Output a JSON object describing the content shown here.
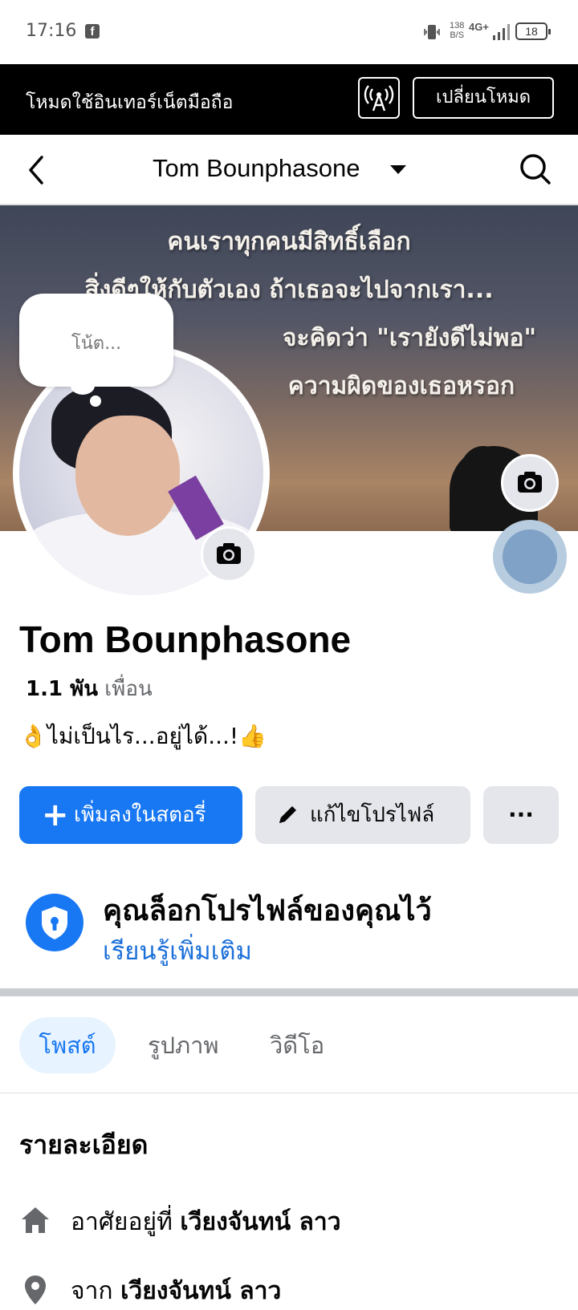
{
  "status_bar": {
    "time": "17:16",
    "app_icon": "facebook-icon",
    "speed_value": "138",
    "speed_unit": "B/S",
    "network": "4G+",
    "battery": "18"
  },
  "data_banner": {
    "text": "โหมดใช้อินเทอร์เน็ตมือถือ",
    "switch_label": "เปลี่ยนโหมด"
  },
  "header": {
    "title": "Tom Bounphasone"
  },
  "cover": {
    "lines": [
      "คนเราทุกคนมีสิทธิ์เลือก",
      "สิ่งดีๆให้กับตัวเอง ถ้าเธอจะไปจากเรา...",
      "จะคิดว่า \"เรายังดีไม่พอ\"",
      "ความผิดของเธอหรอก"
    ]
  },
  "note": {
    "placeholder": "โน้ต..."
  },
  "profile": {
    "name": "Tom Bounphasone",
    "friends_count": "1.1 พัน",
    "friends_label": "เพื่อน",
    "bio": "👌ไม่เป็นไร...อยู่ได้...!👍"
  },
  "actions": {
    "add_story": "เพิ่มลงในสตอรี่",
    "edit_profile": "แก้ไขโปรไฟล์",
    "more": "···"
  },
  "lock_notice": {
    "title": "คุณล็อกโปรไฟล์ของคุณไว้",
    "link": "เรียนรู้เพิ่มเติม"
  },
  "tabs": [
    {
      "label": "โพสต์",
      "active": true
    },
    {
      "label": "รูปภาพ",
      "active": false
    },
    {
      "label": "วิดีโอ",
      "active": false
    }
  ],
  "details": {
    "title": "รายละเอียด",
    "lives_prefix": "อาศัยอยู่ที่",
    "lives_value": "เวียงจันทน์ ลาว",
    "from_prefix": "จาก",
    "from_value": "เวียงจันทน์ ลาว"
  },
  "colors": {
    "accent": "#1877f2",
    "link": "#1b6fd9",
    "banner_bg": "#000000"
  }
}
